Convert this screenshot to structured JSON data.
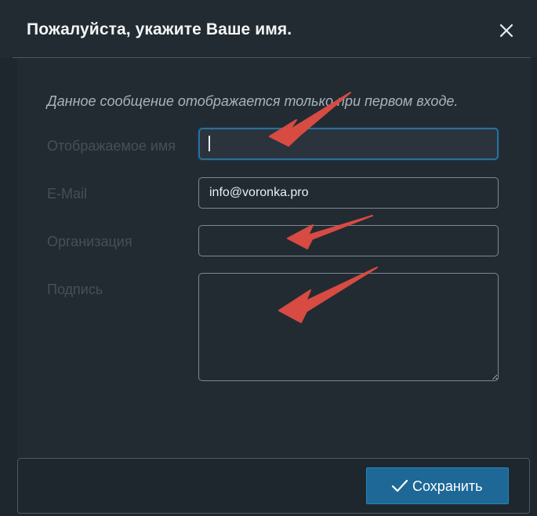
{
  "dialog": {
    "title": "Пожалуйста, укажите Ваше имя.",
    "close_icon": "close-icon"
  },
  "notice": "Данное сообщение отображается только при первом входе.",
  "fields": {
    "display_name": {
      "label": "Отображаемое имя",
      "value": ""
    },
    "email": {
      "label": "E-Mail",
      "value": "info@voronka.pro"
    },
    "organization": {
      "label": "Организация",
      "value": ""
    },
    "signature": {
      "label": "Подпись",
      "value": ""
    }
  },
  "footer": {
    "save_label": "Сохранить",
    "save_icon": "checkmark-icon"
  },
  "annotations": {
    "arrow_color": "#d74b43"
  },
  "colors": {
    "background": "#1f272e",
    "accent": "#1d6896",
    "focus": "#2d6f9a"
  }
}
